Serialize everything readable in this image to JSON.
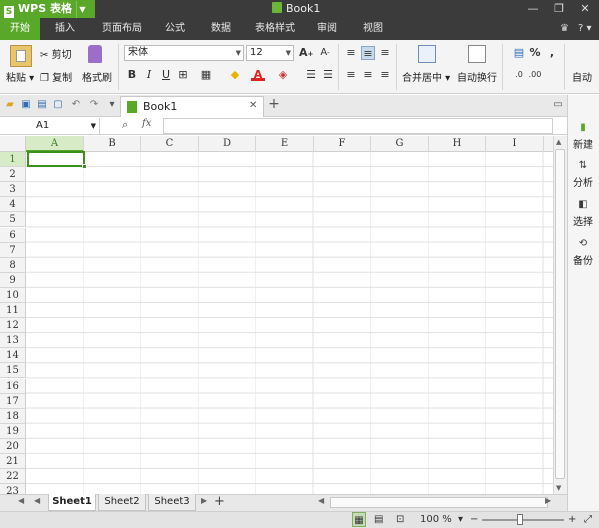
{
  "app": {
    "menu_label": "WPS 表格",
    "logo_letter": "S",
    "doc_title": "Book1"
  },
  "window": {
    "help": "?",
    "skin": "♛"
  },
  "tabs": [
    "开始",
    "插入",
    "页面布局",
    "公式",
    "数据",
    "表格样式",
    "审阅",
    "视图"
  ],
  "ribbon": {
    "paste": "粘贴",
    "cut": "剪切",
    "copy": "复制",
    "format_painter": "格式刷",
    "font_name": "宋体",
    "font_size": "12",
    "bold": "B",
    "italic": "I",
    "underline": "U",
    "merge_center": "合并居中",
    "wrap_text": "自动换行",
    "percent": "%",
    "comma": ",",
    "auto": "自动"
  },
  "doc_tab": {
    "label": "Book1"
  },
  "formula_bar": {
    "name_box": "A1",
    "fx": "fx",
    "formula": ""
  },
  "columns": [
    "A",
    "B",
    "C",
    "D",
    "E",
    "F",
    "G",
    "H",
    "I"
  ],
  "rows": [
    "1",
    "2",
    "3",
    "4",
    "5",
    "6",
    "7",
    "8",
    "9",
    "10",
    "11",
    "12",
    "13",
    "14",
    "15",
    "16",
    "17",
    "18",
    "19",
    "20",
    "21",
    "22",
    "23"
  ],
  "sidebar": {
    "new": "新建",
    "analysis": "分析",
    "select": "选择",
    "backup": "备份"
  },
  "sheets": [
    "Sheet1",
    "Sheet2",
    "Sheet3"
  ],
  "status": {
    "zoom": "100 %"
  },
  "colors": {
    "accent": "#5aa82a",
    "titlebar": "#3b3b3b"
  }
}
